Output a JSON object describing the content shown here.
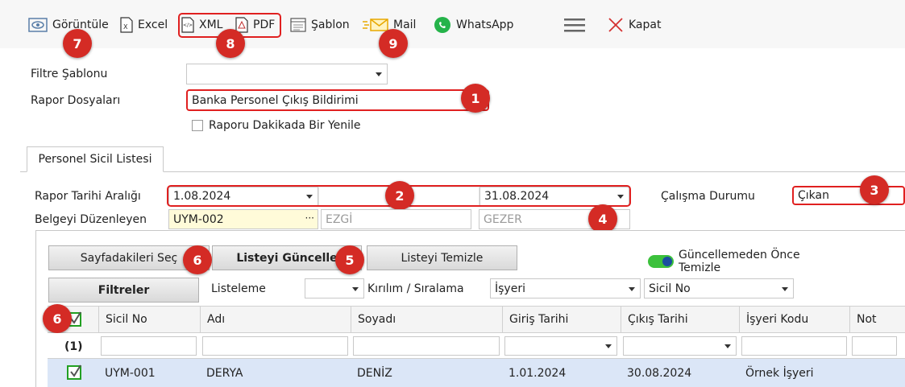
{
  "toolbar": {
    "view_label": "Görüntüle",
    "excel_label": "Excel",
    "xml_label": "XML",
    "pdf_label": "PDF",
    "template_label": "Şablon",
    "mail_label": "Mail",
    "whatsapp_label": "WhatsApp",
    "close_label": "Kapat"
  },
  "badges": {
    "b1": "1",
    "b2": "2",
    "b3": "3",
    "b4": "4",
    "b5": "5",
    "b6a": "6",
    "b6b": "6",
    "b7": "7",
    "b8": "8",
    "b9": "9"
  },
  "form": {
    "filter_template_label": "Filtre Şablonu",
    "filter_template_value": "",
    "report_files_label": "Rapor Dosyaları",
    "report_files_value": "Banka Personel Çıkış Bildirimi",
    "refresh_label": "Raporu Dakikada Bir Yenile"
  },
  "tab": {
    "label": "Personel Sicil Listesi"
  },
  "params": {
    "date_range_label": "Rapor Tarihi Aralığı",
    "date_from": "1.08.2024",
    "date_to": "31.08.2024",
    "work_status_label": "Çalışma Durumu",
    "work_status_value": "Çıkan",
    "editor_label": "Belgeyi Düzenleyen",
    "editor_code": "UYM-002",
    "editor_first_name": "EZGİ",
    "editor_last_name": "GEZER"
  },
  "actions": {
    "select_page_label": "Sayfadakileri Seç",
    "update_list_label": "Listeyi Güncelle",
    "clear_list_label": "Listeyi Temizle",
    "clear_before_update_label": "Güncellemeden Önce Temizle",
    "filters_label": "Filtreler",
    "listing_label": "Listeleme",
    "listing_value": "",
    "grouping_label": "Kırılım / Sıralama",
    "grouping_value_1": "İşyeri",
    "grouping_value_2": "Sicil No"
  },
  "grid": {
    "columns": [
      "Sicil No",
      "Adı",
      "Soyadı",
      "Giriş Tarihi",
      "Çıkış Tarihi",
      "İşyeri Kodu",
      "Not"
    ],
    "filter_count": "(1)",
    "rows": [
      {
        "sicil_no": "UYM-001",
        "adi": "DERYA",
        "soyadi": "DENİZ",
        "giris": "1.01.2024",
        "cikis": "30.08.2024",
        "isyeri": "Örnek İşyeri",
        "not": ""
      }
    ]
  },
  "colors": {
    "badge": "#d42b25",
    "highlight": "#e02020",
    "selected_row": "#dbe6f7",
    "toggle_on": "#3cc13c"
  }
}
